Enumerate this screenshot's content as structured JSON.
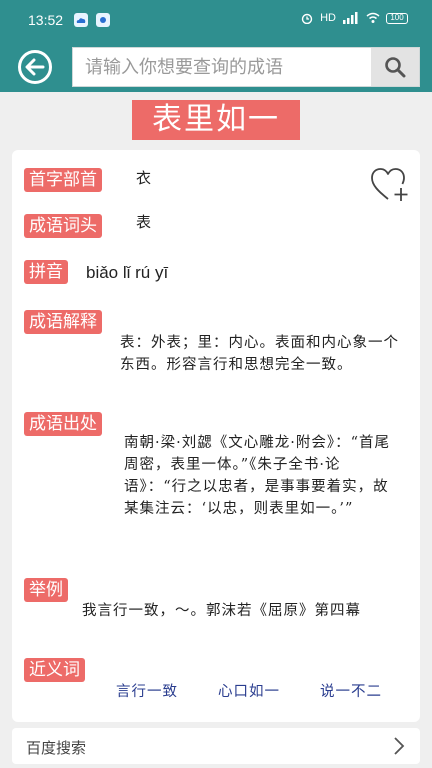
{
  "status": {
    "time": "13:52",
    "network": "HD",
    "signal": "4G",
    "battery": "100"
  },
  "search": {
    "placeholder": "请输入你想要查询的成语"
  },
  "idiom": {
    "title": "表里如一",
    "sections": {
      "radical_label": "首字部首",
      "radical_value": "衣",
      "head_label": "成语词头",
      "head_value": "表",
      "pinyin_label": "拼音",
      "pinyin_value": "biǎo lǐ rú yī",
      "meaning_label": "成语解释",
      "meaning_text": "表：外表；里：内心。表面和内心象一个东西。形容言行和思想完全一致。",
      "source_label": "成语出处",
      "source_text": "南朝·梁·刘勰《文心雕龙·附会》：“首尾周密，表里一体。”《朱子全书·论语》：“行之以忠者，是事事要着实，故某集注云：‘以忠，则表里如一。’”",
      "example_label": "举例",
      "example_text": "我言行一致，～。郭沫若《屈原》第四幕",
      "synonym_label": "近义词",
      "synonyms": [
        "言行一致",
        "心口如一",
        "说一不二"
      ]
    }
  },
  "baidu": {
    "label": "百度搜索"
  },
  "icons": [
    "back-arrow-icon",
    "search-icon",
    "heart-plus-icon",
    "chevron-right-icon"
  ],
  "colors": {
    "header": "#2f8f8f",
    "label": "#ed6b68",
    "synonym": "#2a3d8f"
  }
}
